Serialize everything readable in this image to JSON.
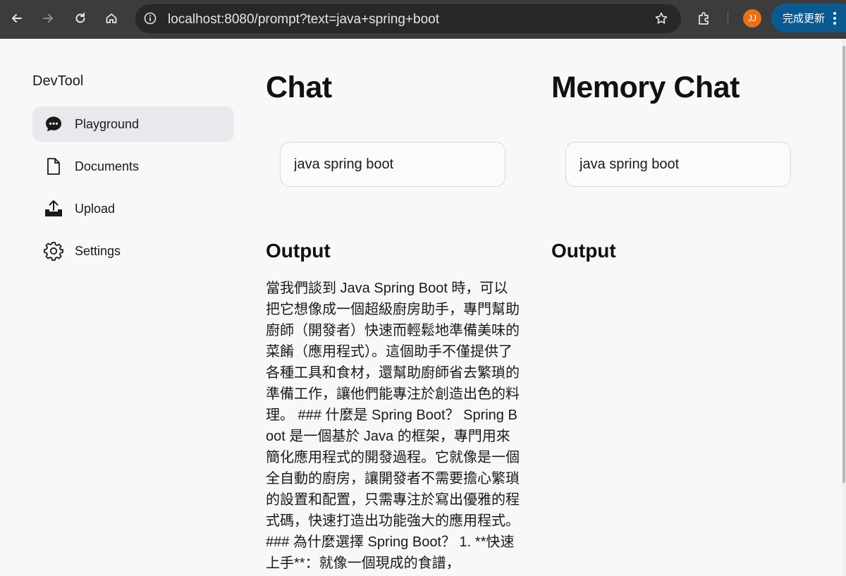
{
  "browser": {
    "url": "localhost:8080/prompt?text=java+spring+boot",
    "avatar_initials": "JJ",
    "update_label": "完成更新"
  },
  "sidebar": {
    "brand": "DevTool",
    "items": [
      {
        "label": "Playground",
        "icon": "chat-bubble-icon",
        "active": true
      },
      {
        "label": "Documents",
        "icon": "document-icon",
        "active": false
      },
      {
        "label": "Upload",
        "icon": "upload-icon",
        "active": false
      },
      {
        "label": "Settings",
        "icon": "gear-icon",
        "active": false
      }
    ]
  },
  "chat": {
    "title": "Chat",
    "input_value": "java spring boot",
    "output_title": "Output",
    "output_text": "當我們談到 Java Spring Boot 時，可以把它想像成一個超級廚房助手，專門幫助廚師（開發者）快速而輕鬆地準備美味的菜餚（應用程式）。這個助手不僅提供了各種工具和食材，還幫助廚師省去繁瑣的準備工作，讓他們能專注於創造出色的料理。 ### 什麼是 Spring Boot？ Spring Boot 是一個基於 Java 的框架，專門用來簡化應用程式的開發過程。它就像是一個全自動的廚房，讓開發者不需要擔心繁瑣的設置和配置，只需專注於寫出優雅的程式碼，快速打造出功能強大的應用程式。 ### 為什麼選擇 Spring Boot？ 1. **快速上手**：就像一個現成的食譜，"
  },
  "memory_chat": {
    "title": "Memory Chat",
    "input_value": "java spring boot",
    "output_title": "Output"
  }
}
